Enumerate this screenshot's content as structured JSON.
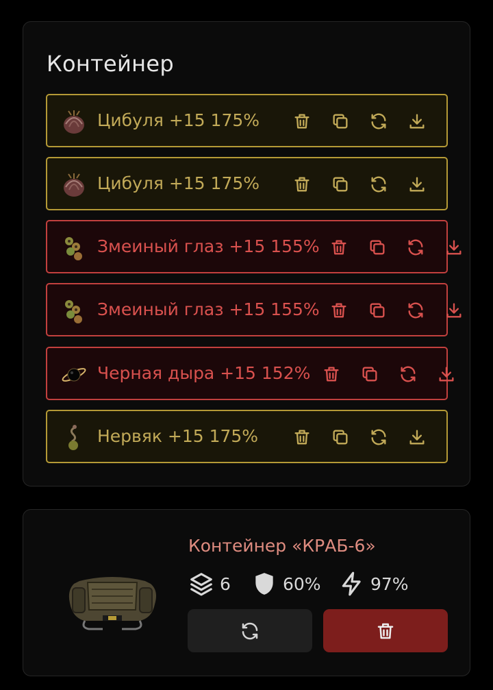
{
  "container": {
    "title": "Контейнер",
    "items": [
      {
        "name": "Цибуля +15 175%",
        "icon": "onion-artifact-icon",
        "status": "gold"
      },
      {
        "name": "Цибуля +15 175%",
        "icon": "onion-artifact-icon",
        "status": "gold"
      },
      {
        "name": "Змеиный глаз +15 155%",
        "icon": "snake-eye-artifact-icon",
        "status": "red"
      },
      {
        "name": "Змеиный глаз +15 155%",
        "icon": "snake-eye-artifact-icon",
        "status": "red"
      },
      {
        "name": "Черная дыра +15 152%",
        "icon": "black-hole-artifact-icon",
        "status": "red"
      },
      {
        "name": "Нервяк +15 175%",
        "icon": "nerve-artifact-icon",
        "status": "gold"
      }
    ],
    "actions": [
      "trash-icon",
      "copy-icon",
      "refresh-icon",
      "download-icon"
    ]
  },
  "info": {
    "title": "Контейнер «КРАБ-6»",
    "image": "crab-6-container-image",
    "stats": {
      "slots": "6",
      "protection": "60%",
      "efficiency": "97%"
    },
    "buttons": [
      "refresh-icon",
      "trash-icon"
    ]
  },
  "colors": {
    "gold": "#c2aa58",
    "red": "#d9514e",
    "accent_title": "#df8c80",
    "delete_button": "#7d1e1c"
  }
}
